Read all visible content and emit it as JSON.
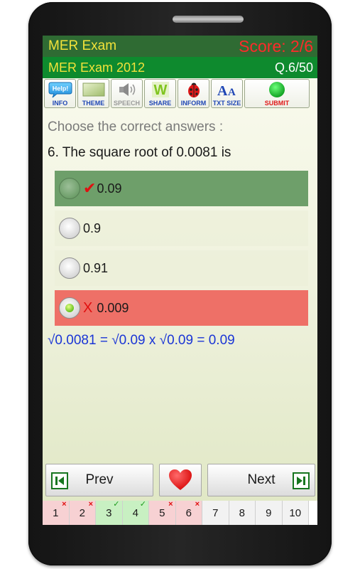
{
  "header": {
    "app_title": "MER Exam",
    "score": "Score: 2/6",
    "exam_name": "MER Exam 2012",
    "question_counter": "Q.6/50"
  },
  "toolbar": {
    "buttons": [
      {
        "label": "INFO",
        "icon": "help-icon"
      },
      {
        "label": "THEME",
        "icon": "theme-swatch-icon"
      },
      {
        "label": "SPEECH",
        "icon": "speaker-icon",
        "disabled": true
      },
      {
        "label": "SHARE",
        "icon": "share-w-icon"
      },
      {
        "label": "INFORM",
        "icon": "ladybug-icon"
      },
      {
        "label": "TXT SIZE",
        "icon": "text-size-icon",
        "glyph": "AA"
      },
      {
        "label": "SUBMIT",
        "icon": "green-circle-icon"
      }
    ]
  },
  "instruction": "Choose the correct answers :",
  "question": "6. The square root of 0.0081 is",
  "options": [
    {
      "text": "0.09",
      "state": "correct",
      "selected": false,
      "marker": "✔"
    },
    {
      "text": "0.9",
      "state": "neutral",
      "selected": false
    },
    {
      "text": "0.91",
      "state": "neutral",
      "selected": false
    },
    {
      "text": "0.009",
      "state": "wrong",
      "selected": true,
      "marker": "X"
    }
  ],
  "explanation": "√0.0081 = √0.09 x √0.09 = 0.09",
  "nav": {
    "prev_label": "Prev",
    "next_label": "Next"
  },
  "pager": [
    {
      "num": "1",
      "status": "wrong",
      "badge": "×"
    },
    {
      "num": "2",
      "status": "wrong",
      "badge": "×"
    },
    {
      "num": "3",
      "status": "right",
      "badge": "✓"
    },
    {
      "num": "4",
      "status": "right",
      "badge": "✓"
    },
    {
      "num": "5",
      "status": "wrong",
      "badge": "×"
    },
    {
      "num": "6",
      "status": "wrong",
      "badge": "×"
    },
    {
      "num": "7",
      "status": "none",
      "badge": ""
    },
    {
      "num": "8",
      "status": "none",
      "badge": ""
    },
    {
      "num": "9",
      "status": "none",
      "badge": ""
    },
    {
      "num": "10",
      "status": "none",
      "badge": ""
    }
  ],
  "colors": {
    "title_bar": "#2f6b33",
    "sub_bar": "#0e8a2e",
    "title_text": "#f2e23a",
    "score_text": "#ff2a2a",
    "correct_option": "#6e9f6a",
    "wrong_option": "#ee7067",
    "explanation_text": "#1a35d6"
  }
}
